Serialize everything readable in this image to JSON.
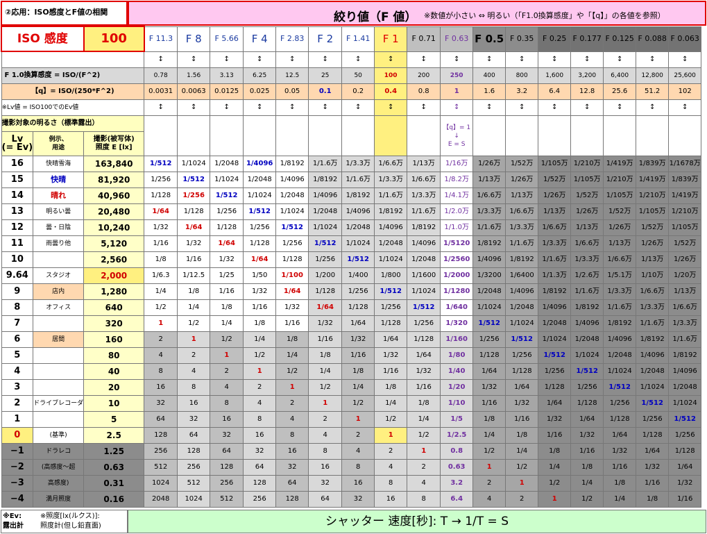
{
  "title_left": "②応用：ISO感度とF値の相関",
  "title_main": "絞り値（F 値）",
  "title_note": "※数値が小さい ⇔ 明るい（「F1.0換算感度」や「【q】」の各値を参照）",
  "iso_label": "ISO 感度",
  "iso_value": "100",
  "fnums": [
    "F 11.3",
    "F 8",
    "F 5.66",
    "F 4",
    "F 2.83",
    "F 2",
    "F 1.41",
    "F 1",
    "F 0.71",
    "F 0.63",
    "F 0.5",
    "F 0.35",
    "F 0.25",
    "F 0.177",
    "F 0.125",
    "F 0.088",
    "F 0.063"
  ],
  "arrow": "↕",
  "row_equiv_label": "F 1.0換算感度 = ISO/(F^2)",
  "row_equiv": [
    "0.78",
    "1.56",
    "3.13",
    "6.25",
    "12.5",
    "25",
    "50",
    "100",
    "200",
    "250",
    "400",
    "800",
    "1,600",
    "3,200",
    "6,400",
    "12,800",
    "25,600"
  ],
  "row_q_label": "【q】= ISO/(250*F^2)",
  "row_q": [
    "0.0031",
    "0.0063",
    "0.0125",
    "0.025",
    "0.05",
    "0.1",
    "0.2",
    "0.4",
    "0.8",
    "1",
    "1.6",
    "3.2",
    "6.4",
    "12.8",
    "25.6",
    "51.2",
    "102"
  ],
  "row_lvnote": "※Lv値 = ISO100でのEv値",
  "header_brightness": "撮影対象の明るさ（標準露出）",
  "header_lv": "Lv\n(= Ev)",
  "header_example": "例示、\n用途",
  "header_lux": "撮影(被写体)\n照度 E [lx]",
  "q_note": "【q】= 1\n↓\nE = S",
  "body_rows": [
    {
      "lv": "16",
      "ex": "快晴雪海",
      "lux": "163,840",
      "cells": [
        "1/512",
        "1/1024",
        "1/2048",
        "1/4096",
        "1/8192",
        "1/1.6万",
        "1/3.3万",
        "1/6.6万",
        "1/13万",
        "1/16万",
        "1/26万",
        "1/52万",
        "1/105万",
        "1/210万",
        "1/419万",
        "1/839万",
        "1/1678万"
      ]
    },
    {
      "lv": "15",
      "ex": "快晴",
      "lux": "81,920",
      "cells": [
        "1/256",
        "1/512",
        "1/1024",
        "1/2048",
        "1/4096",
        "1/8192",
        "1/1.6万",
        "1/3.3万",
        "1/6.6万",
        "1/8.2万",
        "1/13万",
        "1/26万",
        "1/52万",
        "1/105万",
        "1/210万",
        "1/419万",
        "1/839万"
      ]
    },
    {
      "lv": "14",
      "ex": "晴れ",
      "lux": "40,960",
      "cells": [
        "1/128",
        "1/256",
        "1/512",
        "1/1024",
        "1/2048",
        "1/4096",
        "1/8192",
        "1/1.6万",
        "1/3.3万",
        "1/4.1万",
        "1/6.6万",
        "1/13万",
        "1/26万",
        "1/52万",
        "1/105万",
        "1/210万",
        "1/419万"
      ]
    },
    {
      "lv": "13",
      "ex": "明るい曇",
      "lux": "20,480",
      "cells": [
        "1/64",
        "1/128",
        "1/256",
        "1/512",
        "1/1024",
        "1/2048",
        "1/4096",
        "1/8192",
        "1/1.6万",
        "1/2.0万",
        "1/3.3万",
        "1/6.6万",
        "1/13万",
        "1/26万",
        "1/52万",
        "1/105万",
        "1/210万"
      ]
    },
    {
      "lv": "12",
      "ex": "曇・日陰",
      "lux": "10,240",
      "cells": [
        "1/32",
        "1/64",
        "1/128",
        "1/256",
        "1/512",
        "1/1024",
        "1/2048",
        "1/4096",
        "1/8192",
        "1/1.0万",
        "1/1.6万",
        "1/3.3万",
        "1/6.6万",
        "1/13万",
        "1/26万",
        "1/52万",
        "1/105万"
      ]
    },
    {
      "lv": "11",
      "ex": "雨曇り他",
      "lux": "5,120",
      "cells": [
        "1/16",
        "1/32",
        "1/64",
        "1/128",
        "1/256",
        "1/512",
        "1/1024",
        "1/2048",
        "1/4096",
        "1/5120",
        "1/8192",
        "1/1.6万",
        "1/3.3万",
        "1/6.6万",
        "1/13万",
        "1/26万",
        "1/52万"
      ]
    },
    {
      "lv": "10",
      "ex": "",
      "lux": "2,560",
      "cells": [
        "1/8",
        "1/16",
        "1/32",
        "1/64",
        "1/128",
        "1/256",
        "1/512",
        "1/1024",
        "1/2048",
        "1/2560",
        "1/4096",
        "1/8192",
        "1/1.6万",
        "1/3.3万",
        "1/6.6万",
        "1/13万",
        "1/26万"
      ]
    },
    {
      "lv": "9.64",
      "ex": "スタジオ",
      "lux": "2,000",
      "cells": [
        "1/6.3",
        "1/12.5",
        "1/25",
        "1/50",
        "1/100",
        "1/200",
        "1/400",
        "1/800",
        "1/1600",
        "1/2000",
        "1/3200",
        "1/6400",
        "1/1.3万",
        "1/2.6万",
        "1/5.1万",
        "1/10万",
        "1/20万"
      ]
    },
    {
      "lv": "9",
      "ex": "店内",
      "lux": "1,280",
      "cells": [
        "1/4",
        "1/8",
        "1/16",
        "1/32",
        "1/64",
        "1/128",
        "1/256",
        "1/512",
        "1/1024",
        "1/1280",
        "1/2048",
        "1/4096",
        "1/8192",
        "1/1.6万",
        "1/3.3万",
        "1/6.6万",
        "1/13万"
      ]
    },
    {
      "lv": "8",
      "ex": "オフィス",
      "lux": "640",
      "cells": [
        "1/2",
        "1/4",
        "1/8",
        "1/16",
        "1/32",
        "1/64",
        "1/128",
        "1/256",
        "1/512",
        "1/640",
        "1/1024",
        "1/2048",
        "1/4096",
        "1/8192",
        "1/1.6万",
        "1/3.3万",
        "1/6.6万"
      ]
    },
    {
      "lv": "7",
      "ex": "",
      "lux": "320",
      "cells": [
        "1",
        "1/2",
        "1/4",
        "1/8",
        "1/16",
        "1/32",
        "1/64",
        "1/128",
        "1/256",
        "1/320",
        "1/512",
        "1/1024",
        "1/2048",
        "1/4096",
        "1/8192",
        "1/1.6万",
        "1/3.3万"
      ]
    },
    {
      "lv": "6",
      "ex": "居間",
      "lux": "160",
      "cells": [
        "2",
        "1",
        "1/2",
        "1/4",
        "1/8",
        "1/16",
        "1/32",
        "1/64",
        "1/128",
        "1/160",
        "1/256",
        "1/512",
        "1/1024",
        "1/2048",
        "1/4096",
        "1/8192",
        "1/1.6万"
      ]
    },
    {
      "lv": "5",
      "ex": "",
      "lux": "80",
      "cells": [
        "4",
        "2",
        "1",
        "1/2",
        "1/4",
        "1/8",
        "1/16",
        "1/32",
        "1/64",
        "1/80",
        "1/128",
        "1/256",
        "1/512",
        "1/1024",
        "1/2048",
        "1/4096",
        "1/8192"
      ]
    },
    {
      "lv": "4",
      "ex": "",
      "lux": "40",
      "cells": [
        "8",
        "4",
        "2",
        "1",
        "1/2",
        "1/4",
        "1/8",
        "1/16",
        "1/32",
        "1/40",
        "1/64",
        "1/128",
        "1/256",
        "1/512",
        "1/1024",
        "1/2048",
        "1/4096"
      ]
    },
    {
      "lv": "3",
      "ex": "",
      "lux": "20",
      "cells": [
        "16",
        "8",
        "4",
        "2",
        "1",
        "1/2",
        "1/4",
        "1/8",
        "1/16",
        "1/20",
        "1/32",
        "1/64",
        "1/128",
        "1/256",
        "1/512",
        "1/1024",
        "1/2048"
      ]
    },
    {
      "lv": "2",
      "ex": "ドライブレコーダ",
      "lux": "10",
      "cells": [
        "32",
        "16",
        "8",
        "4",
        "2",
        "1",
        "1/2",
        "1/4",
        "1/8",
        "1/10",
        "1/16",
        "1/32",
        "1/64",
        "1/128",
        "1/256",
        "1/512",
        "1/1024"
      ]
    },
    {
      "lv": "1",
      "ex": "",
      "lux": "5",
      "cells": [
        "64",
        "32",
        "16",
        "8",
        "4",
        "2",
        "1",
        "1/2",
        "1/4",
        "1/5",
        "1/8",
        "1/16",
        "1/32",
        "1/64",
        "1/128",
        "1/256",
        "1/512"
      ]
    },
    {
      "lv": "0",
      "ex": "(基準)",
      "lux": "2.5",
      "cells": [
        "128",
        "64",
        "32",
        "16",
        "8",
        "4",
        "2",
        "1",
        "1/2",
        "1/2.5",
        "1/4",
        "1/8",
        "1/16",
        "1/32",
        "1/64",
        "1/128",
        "1/256"
      ]
    },
    {
      "lv": "−1",
      "ex": "ドラレコ",
      "lux": "1.25",
      "cells": [
        "256",
        "128",
        "64",
        "32",
        "16",
        "8",
        "4",
        "2",
        "1",
        "0.8",
        "1/2",
        "1/4",
        "1/8",
        "1/16",
        "1/32",
        "1/64",
        "1/128"
      ]
    },
    {
      "lv": "−2",
      "ex": "(高感度〜超",
      "lux": "0.63",
      "cells": [
        "512",
        "256",
        "128",
        "64",
        "32",
        "16",
        "8",
        "4",
        "2",
        "0.63",
        "1",
        "1/2",
        "1/4",
        "1/8",
        "1/16",
        "1/32",
        "1/64"
      ]
    },
    {
      "lv": "−3",
      "ex": "高感度)",
      "lux": "0.31",
      "cells": [
        "1024",
        "512",
        "256",
        "128",
        "64",
        "32",
        "16",
        "8",
        "4",
        "3.2",
        "2",
        "1",
        "1/2",
        "1/4",
        "1/8",
        "1/16",
        "1/32"
      ]
    },
    {
      "lv": "−4",
      "ex": "満月照度",
      "lux": "0.16",
      "cells": [
        "2048",
        "1024",
        "512",
        "256",
        "128",
        "64",
        "32",
        "16",
        "8",
        "6.4",
        "4",
        "2",
        "1",
        "1/2",
        "1/4",
        "1/8",
        "1/16"
      ]
    }
  ],
  "footer_left1": "※Ev:\n露出計",
  "footer_left2": "※照度[lx(ルクス)]:\n照度計(但し鉛直面)",
  "footer_main": "シャッター 速度[秒]: T → 1/T = S",
  "colors": {
    "title_pink": "#ffc8f0",
    "title_border": "#e00000",
    "f1_yellow": "#fff080",
    "footer_green": "#ccffcc",
    "iso_red": "#e00000",
    "blue_text": "#0000c0",
    "red_text": "#d00000",
    "purple_text": "#7030a0"
  }
}
